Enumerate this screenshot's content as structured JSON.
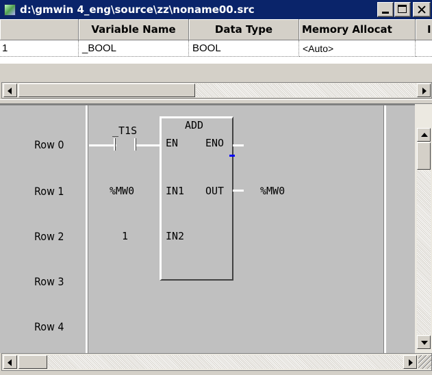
{
  "window": {
    "title": "d:\\gmwin 4_eng\\source\\zz\\noname00.src"
  },
  "variables": {
    "columns": [
      "",
      "Variable Name",
      "Data Type",
      "Memory Allocat",
      "I"
    ],
    "rows": [
      {
        "index": "1",
        "name": "_BOOL",
        "type": "BOOL",
        "memory": "<Auto>"
      }
    ]
  },
  "ladder": {
    "rows": [
      "Row 0",
      "Row 1",
      "Row 2",
      "Row 3",
      "Row 4"
    ],
    "contact_label": "_T1S",
    "block": {
      "name": "ADD",
      "en": "EN",
      "eno": "ENO",
      "in1": "IN1",
      "in2": "IN2",
      "out": "OUT"
    },
    "in1_operand": "%MW0",
    "in2_operand": "1",
    "out_operand": "%MW0"
  },
  "colors": {
    "titlebar": "#0a246a",
    "ladder_bg": "#c0c0c0",
    "window_face": "#d4d0c8",
    "cursor": "#0000ff"
  }
}
